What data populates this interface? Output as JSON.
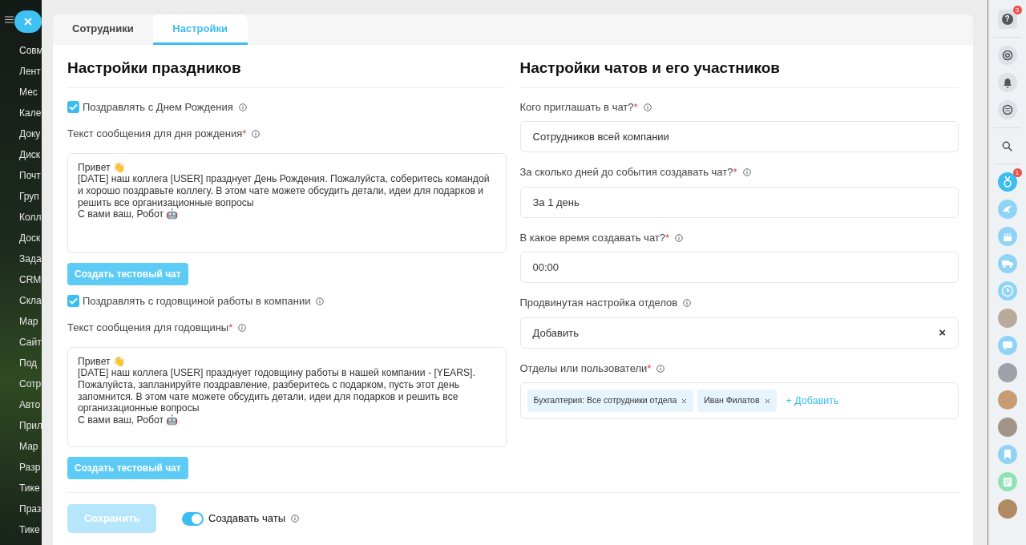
{
  "left_menu": {
    "items": [
      "Совм",
      "Лент",
      "Мес",
      "Кале",
      "Доку",
      "Диск",
      "Почт",
      "Груп",
      "Колл",
      "Доск",
      "Зада",
      "CRM",
      "Скла",
      "Мар",
      "Сайт",
      "Под",
      "Сотр",
      "Авто",
      "Прил",
      "Мар",
      "Разр",
      "Тике",
      "Праз",
      "Тике"
    ]
  },
  "tabs": [
    {
      "label": "Сотрудники",
      "selected": false
    },
    {
      "label": "Настройки",
      "selected": true
    }
  ],
  "holidays": {
    "title": "Настройки праздников",
    "sections": [
      {
        "checkbox": {
          "label": "Поздравлять с Днем Рождения",
          "checked": true
        },
        "message_label": "Текст сообщения для дня рождения",
        "required_mark": "*",
        "message": "Привет 👋\n[DATE] наш коллега [USER] празднует День Рождения. Пожалуйста, соберитесь командой и хорошо поздравьте коллегу. В этом чате можете обсудить детали, идеи для подарков и решить все организационные вопросы\nС вами ваш, Робот 🤖",
        "test_button": "Создать тестовый чат"
      },
      {
        "checkbox": {
          "label": "Поздравлять с годовщиной работы в компании",
          "checked": true
        },
        "message_label": "Текст сообщения для годовщины",
        "required_mark": "*",
        "message": "Привет 👋\n[DATE] наш коллега [USER] празднует годовщину работы в нашей компании - [YEARS]. Пожалуйста, запланируйте поздравление, разберитесь с подарком, пусть этот день запомнится. В этом чате можете обсудить детали, идеи для подарков и решить все организационные вопросы\nС вами ваш, Робот 🤖",
        "test_button": "Создать тестовый чат"
      }
    ]
  },
  "chats": {
    "title": "Настройки чатов и его участников",
    "fields": [
      {
        "kind": "input",
        "label": "Кого приглашать в чат?",
        "required_mark": "*",
        "value": "Сотрудников всей компании"
      },
      {
        "kind": "input",
        "label": "За сколько дней до события создавать чат?",
        "required_mark": "*",
        "value": "За 1 день"
      },
      {
        "kind": "input",
        "label": "В какое время создавать чат?",
        "required_mark": "*",
        "value": "00:00"
      },
      {
        "kind": "clearable",
        "label": "Продвинутая настройка отделов",
        "value": "Добавить",
        "clear": "×"
      },
      {
        "kind": "tags",
        "label": "Отделы или пользователи",
        "required_mark": "*",
        "tags": [
          "Бухгалтерия: Все сотрудники отдела",
          "Иван Филатов"
        ],
        "add": "+ Добавить"
      }
    ]
  },
  "footer": {
    "save": {
      "label": "Сохранить",
      "disabled": true
    },
    "toggle": {
      "label": "Создавать чаты",
      "on": true
    }
  },
  "right_bar": {
    "help_icon": "?",
    "help_badge": "3",
    "award_badge": "1"
  }
}
